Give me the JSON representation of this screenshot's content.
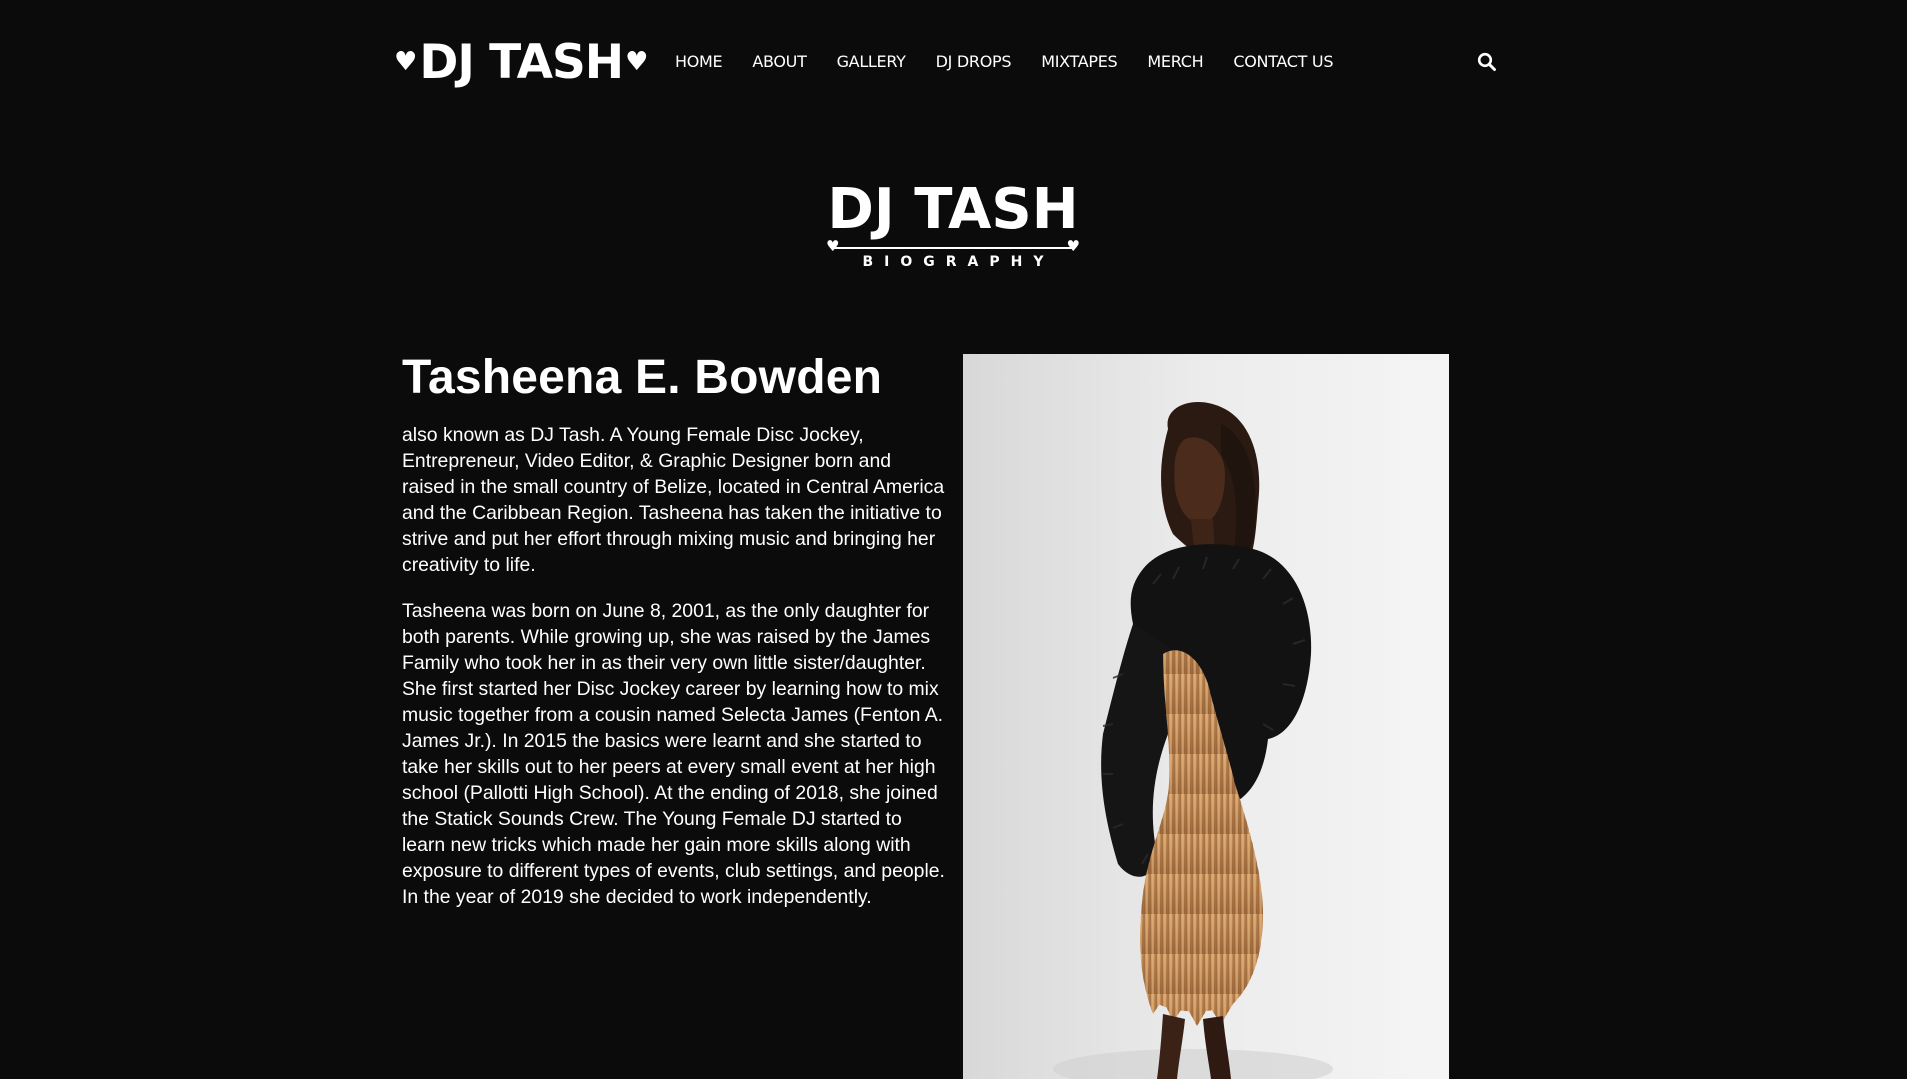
{
  "header": {
    "logo_text": "DJ TASH",
    "logo_heart": "♥",
    "nav": [
      "HOME",
      "ABOUT",
      "GALLERY",
      "DJ DROPS",
      "MIXTAPES",
      "MERCH",
      "CONTACT US"
    ],
    "search_icon": "search-icon"
  },
  "bio_title": {
    "main": "DJ TASH",
    "sub": "BIOGRAPHY",
    "heart": "♥"
  },
  "bio": {
    "name": "Tasheena E. Bowden",
    "paragraph1": "also known as DJ Tash. A Young Female Disc Jockey, Entrepreneur, Video Editor, & Graphic Designer born and raised in the small country of Belize, located in Central America and the Caribbean Region. Tasheena has taken the initiative to strive and put her effort through mixing music and bringing her creativity to life.",
    "paragraph2": "Tasheena was born on June 8, 2001, as the only daughter for both parents. While growing up, she was raised by the James Family who took her in as their very own little sister/daughter. She first started her Disc Jockey career by learning how to mix music together from a cousin named Selecta James (Fenton A. James Jr.). In 2015 the basics were learnt and she started to take her skills out to her peers at every small event at her high school (Pallotti High School). At the ending of 2018, she joined the Statick Sounds Crew. The Young Female DJ started to learn new tricks which made her gain more skills along with exposure to different types of events, club settings, and people. In the year of 2019 she decided to work independently."
  },
  "colors": {
    "background": "#0b0b0c",
    "text": "#ffffff",
    "photo_backdrop": "#eeeeee",
    "fur_jacket": "#121212",
    "gold_dress": "#c8965e"
  }
}
